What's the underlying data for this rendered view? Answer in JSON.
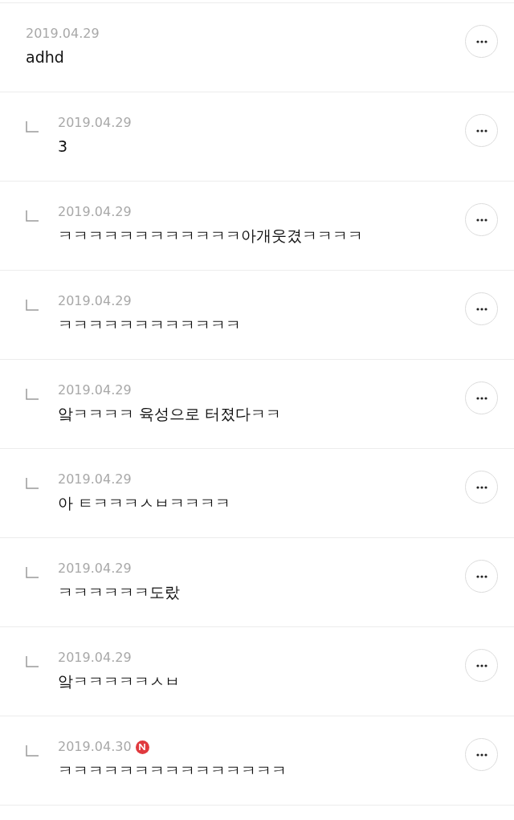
{
  "comments": [
    {
      "kind": "comment",
      "date": "2019.04.29",
      "text": "adhd",
      "new": false
    },
    {
      "kind": "reply",
      "date": "2019.04.29",
      "text": "3",
      "new": false
    },
    {
      "kind": "reply",
      "date": "2019.04.29",
      "text": "ㅋㅋㅋㅋㅋㅋㅋㅋㅋㅋㅋㅋ아개웃겼ㅋㅋㅋㅋ",
      "new": false
    },
    {
      "kind": "reply",
      "date": "2019.04.29",
      "text": "ㅋㅋㅋㅋㅋㅋㅋㅋㅋㅋㅋㅋ",
      "new": false
    },
    {
      "kind": "reply",
      "date": "2019.04.29",
      "text": "앜ㅋㅋㅋㅋ 육성으로 터졌다ㅋㅋ",
      "new": false
    },
    {
      "kind": "reply",
      "date": "2019.04.29",
      "text": "아 ㅌㅋㅋㅋㅅㅂㅋㅋㅋㅋ",
      "new": false
    },
    {
      "kind": "reply",
      "date": "2019.04.29",
      "text": "ㅋㅋㅋㅋㅋㅋ도랐",
      "new": false
    },
    {
      "kind": "reply",
      "date": "2019.04.29",
      "text": "앜ㅋㅋㅋㅋㅋㅅㅂ",
      "new": false
    },
    {
      "kind": "reply",
      "date": "2019.04.30",
      "text": "ㅋㅋㅋㅋㅋㅋㅋㅋㅋㅋㅋㅋㅋㅋㅋ",
      "new": true
    }
  ]
}
